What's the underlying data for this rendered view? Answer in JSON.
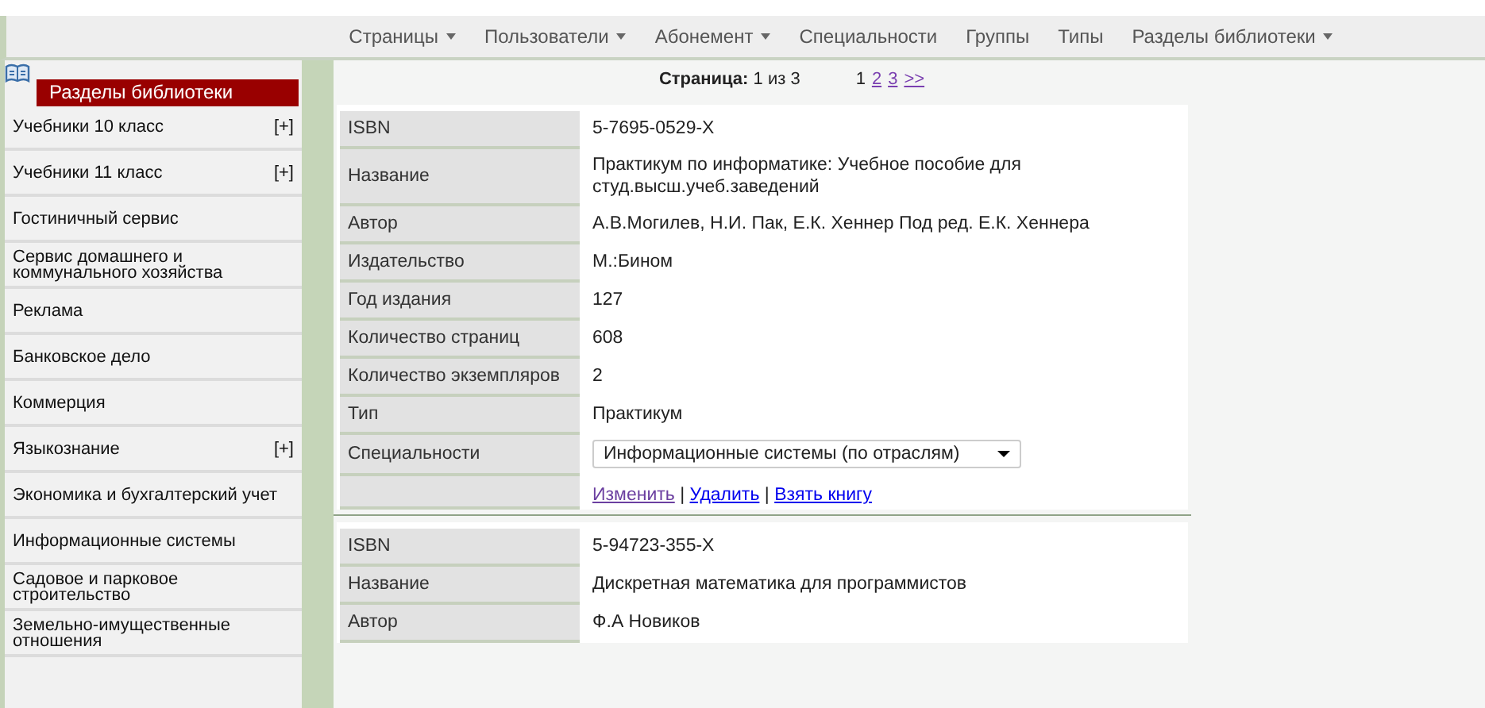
{
  "nav": {
    "items": [
      {
        "label": "Страницы",
        "has_menu": true
      },
      {
        "label": "Пользователи",
        "has_menu": true
      },
      {
        "label": "Абонемент",
        "has_menu": true
      },
      {
        "label": "Специальности",
        "has_menu": false
      },
      {
        "label": "Группы",
        "has_menu": false
      },
      {
        "label": "Типы",
        "has_menu": false
      },
      {
        "label": "Разделы библиотеки",
        "has_menu": true
      }
    ]
  },
  "sidebar": {
    "title": "Разделы библиотеки",
    "items": [
      {
        "label": "Учебники 10 класс",
        "expander": "[+]"
      },
      {
        "label": "Учебники 11 класс",
        "expander": "[+]"
      },
      {
        "label": "Гостиничный сервис"
      },
      {
        "label": "Сервис домашнего и коммунального хозяйства"
      },
      {
        "label": "Реклама"
      },
      {
        "label": "Банковское дело"
      },
      {
        "label": "Коммерция"
      },
      {
        "label": "Языкознание",
        "expander": "[+]"
      },
      {
        "label": "Экономика и бухгалтерский учет"
      },
      {
        "label": "Информационные системы"
      },
      {
        "label": "Садовое и парковое строительство"
      },
      {
        "label": "Земельно-имущественные отношения"
      }
    ]
  },
  "pager": {
    "text": "**Страница:** 1 из 3",
    "pages": [
      {
        "label": "1",
        "current": true
      },
      {
        "label": "2",
        "current": false
      },
      {
        "label": "3",
        "current": false
      },
      {
        "label": ">>",
        "current": false
      }
    ]
  },
  "books": [
    {
      "rows": [
        {
          "kind": "text",
          "label": "ISBN",
          "value": "5-7695-0529-X"
        },
        {
          "kind": "text",
          "label": "Название",
          "value": "Практикум по информатике: Учебное пособие для студ.высш.учеб.заведений"
        },
        {
          "kind": "text",
          "label": "Автор",
          "value": "А.В.Могилев, Н.И. Пак, Е.К. Хеннер Под ред. Е.К. Хеннера"
        },
        {
          "kind": "text",
          "label": "Издательство",
          "value": "М.:Бином"
        },
        {
          "kind": "text",
          "label": "Год издания",
          "value": "127"
        },
        {
          "kind": "text",
          "label": "Количество страниц",
          "value": "608"
        },
        {
          "kind": "text",
          "label": "Количество экземпляров",
          "value": "2"
        },
        {
          "kind": "text",
          "label": "Тип",
          "value": "Практикум"
        },
        {
          "kind": "select",
          "label": "Специальности",
          "value": "Информационные системы (по отраслям)"
        },
        {
          "kind": "actions",
          "separator": "|",
          "links": [
            {
              "label": "Изменить",
              "visited": true
            },
            {
              "label": "Удалить",
              "visited": false
            },
            {
              "label": "Взять книгу",
              "visited": false
            }
          ]
        }
      ]
    },
    {
      "rows": [
        {
          "kind": "text",
          "label": "ISBN",
          "value": "5-94723-355-X"
        },
        {
          "kind": "text",
          "label": "Название",
          "value": "Дискретная математика для программистов"
        },
        {
          "kind": "text",
          "label": "Автор",
          "value": "Ф.А Новиков"
        }
      ]
    }
  ]
}
